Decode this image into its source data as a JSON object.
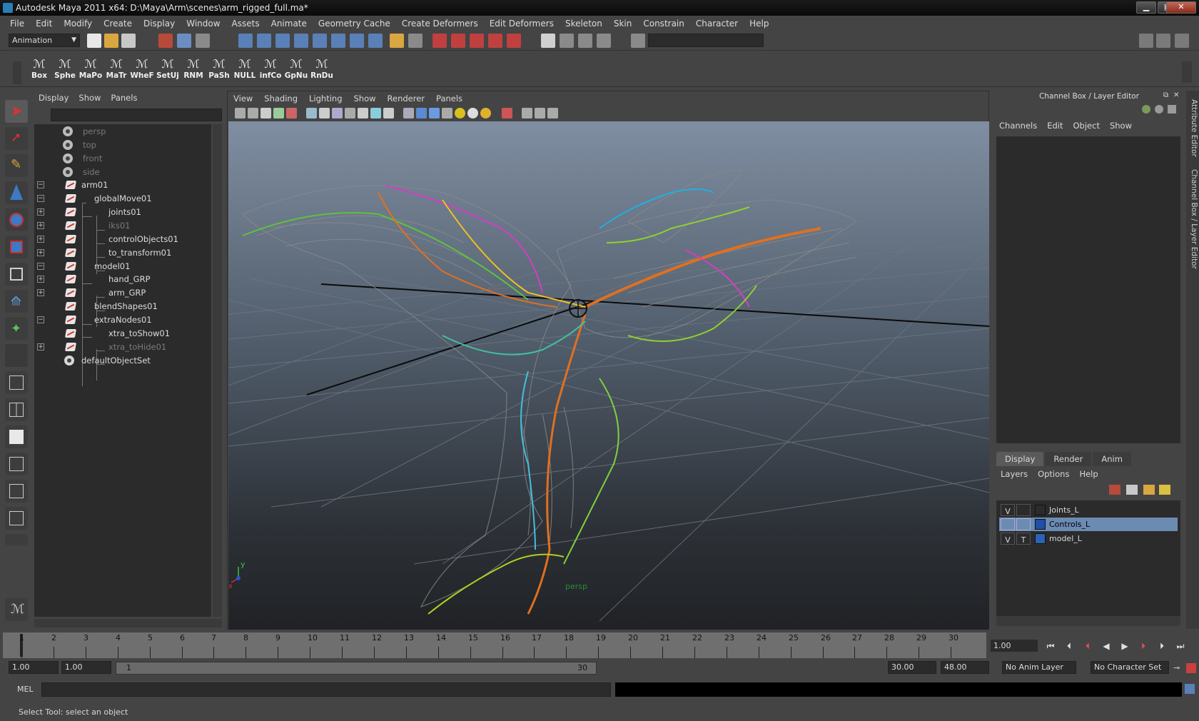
{
  "window": {
    "title": "Autodesk Maya 2011 x64: D:\\Maya\\Arm\\scenes\\arm_rigged_full.ma*"
  },
  "menubar": [
    "File",
    "Edit",
    "Modify",
    "Create",
    "Display",
    "Window",
    "Assets",
    "Animate",
    "Geometry Cache",
    "Create Deformers",
    "Edit Deformers",
    "Skeleton",
    "Skin",
    "Constrain",
    "Character",
    "Help"
  ],
  "statusline": {
    "menuset": "Animation"
  },
  "shelf": [
    "Box",
    "Sphe",
    "MaPo",
    "MaTr",
    "WheF",
    "SetUj",
    "RNM",
    "PaSh",
    "NULL",
    "infCo",
    "GpNu",
    "RnDu"
  ],
  "outliner": {
    "menu": [
      "Display",
      "Show",
      "Panels"
    ],
    "items": [
      {
        "name": "persp",
        "dim": true
      },
      {
        "name": "top",
        "dim": true
      },
      {
        "name": "front",
        "dim": true
      },
      {
        "name": "side",
        "dim": true
      },
      {
        "name": "arm01"
      },
      {
        "name": "globalMove01"
      },
      {
        "name": "joints01"
      },
      {
        "name": "iks01",
        "dim": true
      },
      {
        "name": "controlObjects01"
      },
      {
        "name": "to_transform01"
      },
      {
        "name": "model01"
      },
      {
        "name": "hand_GRP"
      },
      {
        "name": "arm_GRP"
      },
      {
        "name": "blendShapes01"
      },
      {
        "name": "extraNodes01"
      },
      {
        "name": "xtra_toShow01"
      },
      {
        "name": "xtra_toHide01",
        "dim": true
      },
      {
        "name": "defaultObjectSet"
      }
    ]
  },
  "viewport": {
    "menu": [
      "View",
      "Shading",
      "Lighting",
      "Show",
      "Renderer",
      "Panels"
    ],
    "camera_label": "persp",
    "axis_y": "y",
    "axis_x": "x"
  },
  "channelbox": {
    "title": "Channel Box / Layer Editor",
    "menu": [
      "Channels",
      "Edit",
      "Object",
      "Show"
    ],
    "tabs": [
      "Display",
      "Render",
      "Anim"
    ],
    "layer_menu": [
      "Layers",
      "Options",
      "Help"
    ],
    "layers": [
      {
        "v": "V",
        "t": "",
        "name": "Joints_L",
        "color": "#2b2b2b",
        "selected": false
      },
      {
        "v": "",
        "t": "",
        "name": "Controls_L",
        "color": "#1f4fa6",
        "selected": true
      },
      {
        "v": "V",
        "t": "T",
        "name": "model_L",
        "color": "#2b62b3",
        "selected": false
      }
    ]
  },
  "side_tabs": [
    "Attribute Editor",
    "Channel Box / Layer Editor"
  ],
  "timeslider": {
    "frames": [
      "1",
      "2",
      "3",
      "4",
      "5",
      "6",
      "7",
      "8",
      "9",
      "10",
      "11",
      "12",
      "13",
      "14",
      "15",
      "16",
      "17",
      "18",
      "19",
      "20",
      "21",
      "22",
      "23",
      "24",
      "25",
      "26",
      "27",
      "28",
      "29",
      "30"
    ],
    "current_frame": "1.00"
  },
  "range": {
    "start": "1.00",
    "inner_start": "1.00",
    "slider_start": "1",
    "slider_end": "30",
    "end": "30.00",
    "outer_end": "48.00",
    "anim_layer": "No Anim Layer",
    "character_set": "No Character Set"
  },
  "cmdline": {
    "label": "MEL"
  },
  "helpline": "Select Tool: select an object",
  "colors": {
    "accent": "#6c8bb3",
    "panel": "#444444",
    "field": "#2b2b2b"
  }
}
